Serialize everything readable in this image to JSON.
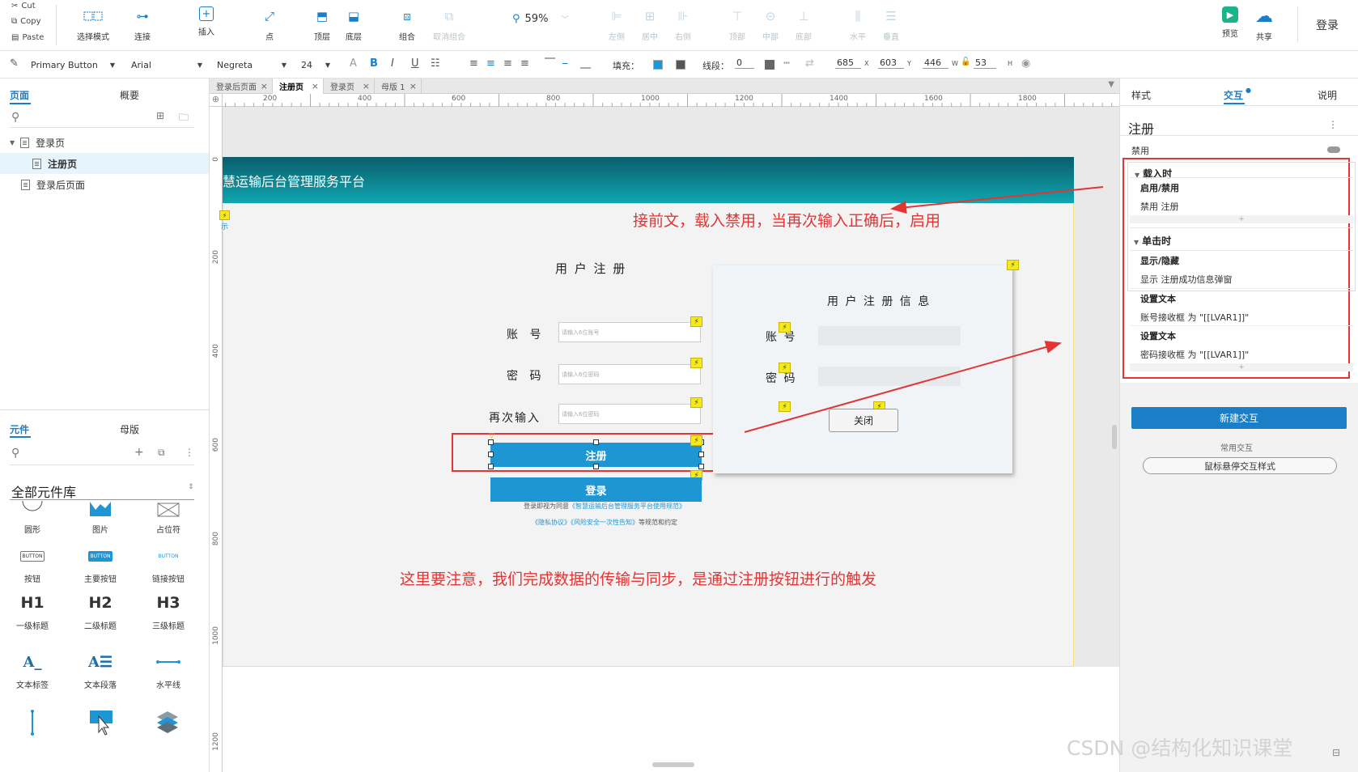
{
  "toolbar": {
    "clipboard": {
      "cut": "Cut",
      "copy": "Copy",
      "paste": "Paste"
    },
    "items": [
      {
        "label": "选择模式",
        "icon": "select-mode-icon"
      },
      {
        "label": "连接",
        "icon": "connect-icon"
      },
      {
        "label": "插入",
        "icon": "insert-icon"
      },
      {
        "label": "点",
        "icon": "point-icon"
      },
      {
        "label": "顶层",
        "icon": "bring-to-front-icon"
      },
      {
        "label": "底层",
        "icon": "send-to-back-icon"
      },
      {
        "label": "组合",
        "icon": "group-icon"
      },
      {
        "label": "取消组合",
        "icon": "ungroup-icon"
      },
      {
        "label": "左侧",
        "icon": "align-left-icon"
      },
      {
        "label": "居中",
        "icon": "align-center-icon"
      },
      {
        "label": "右侧",
        "icon": "align-right-icon"
      },
      {
        "label": "顶部",
        "icon": "align-top-icon"
      },
      {
        "label": "中部",
        "icon": "align-middle-icon"
      },
      {
        "label": "底部",
        "icon": "align-bottom-icon"
      },
      {
        "label": "水平",
        "icon": "distribute-horizontal-icon"
      },
      {
        "label": "垂直",
        "icon": "distribute-vertical-icon"
      },
      {
        "label": "预览",
        "icon": "preview-icon"
      },
      {
        "label": "共享",
        "icon": "share-icon"
      }
    ],
    "zoom": "59%",
    "login": "登录"
  },
  "format": {
    "style": "Primary Button",
    "font": "Arial",
    "weight": "Negreta",
    "size": "24",
    "fill_label": "填充：",
    "stroke_label": "线段：",
    "stroke_value": "0",
    "x": "685",
    "y": "603",
    "w": "446",
    "h": "53",
    "x_label": "X",
    "y_label": "Y",
    "w_label": "W",
    "h_label": "H"
  },
  "left": {
    "tabs": [
      "页面",
      "概要"
    ],
    "pages": [
      "登录页",
      "注册页",
      "登录后页面"
    ],
    "lib_tabs": [
      "元件",
      "母版"
    ],
    "lib_title": "全部元件库",
    "widgets": [
      "圆形",
      "图片",
      "占位符",
      "按钮",
      "主要按钮",
      "链接按钮",
      "一级标题",
      "二级标题",
      "三级标题",
      "文本标签",
      "文本段落",
      "水平线"
    ],
    "widget_glyphs": {
      "btn": "BUTTON",
      "h1": "H1",
      "h2": "H2",
      "h3": "H3",
      "label": "A_",
      "para": "A☰"
    }
  },
  "doc_tabs": [
    "登录后页面",
    "注册页",
    "登录页",
    "母版 1"
  ],
  "ruler": {
    "h": [
      "200",
      "400",
      "600",
      "800",
      "1000",
      "1200",
      "1400",
      "1600",
      "1800"
    ],
    "v": [
      "0",
      "200",
      "400",
      "600",
      "800",
      "1000",
      "1200"
    ]
  },
  "design": {
    "header_title": "慧运输后台管理服务平台",
    "tip": "示",
    "form_title": "用 户 注 册",
    "account_label": "账 号",
    "password_label": "密 码",
    "repeat_label": "再次输入",
    "account_ph": "请输入6位账号",
    "password_ph": "请输入6位密码",
    "repeat_ph": "请输入6位密码",
    "register_btn": "注册",
    "login_btn": "登录",
    "agree_text": "登录即视为同意",
    "agree_link": "《智慧运输后台管理服务平台使用规范》",
    "privacy_link": "《隐私协议》《风险安全一次性告知》",
    "privacy_tail": "等规范和约定",
    "info_title": "用 户 注 册 信 息",
    "info_account": "账  号",
    "info_password": "密  码",
    "close_btn": "关闭"
  },
  "annotations": {
    "note_top": "接前文，载入禁用，当再次输入正确后，启用",
    "note_bottom": "这里要注意，我们完成数据的传输与同步，是通过注册按钮进行的触发"
  },
  "right": {
    "tabs": [
      "样式",
      "交互",
      "说明"
    ],
    "widget_name": "注册",
    "disabled_label": "禁用",
    "events": [
      {
        "name": "载入时",
        "actions": [
          {
            "title": "启用/禁用",
            "desc": "禁用 注册"
          }
        ]
      },
      {
        "name": "单击时",
        "actions": [
          {
            "title": "显示/隐藏",
            "desc": "显示 注册成功信息弹窗"
          },
          {
            "title": "设置文本",
            "desc": "账号接收框 为 \"[[LVAR1]]\""
          },
          {
            "title": "设置文本",
            "desc": "密码接收框 为 \"[[LVAR1]]\""
          }
        ]
      }
    ],
    "add": "+",
    "new_interaction": "新建交互",
    "common_label": "常用交互",
    "hover_style": "鼠标悬停交互样式"
  },
  "watermark": "CSDN @结构化知识课堂",
  "colors": {
    "accent": "#1a7fc7",
    "primary_button": "#1e96d4",
    "annotation": "#e23535",
    "bolt": "#f4e91c"
  }
}
